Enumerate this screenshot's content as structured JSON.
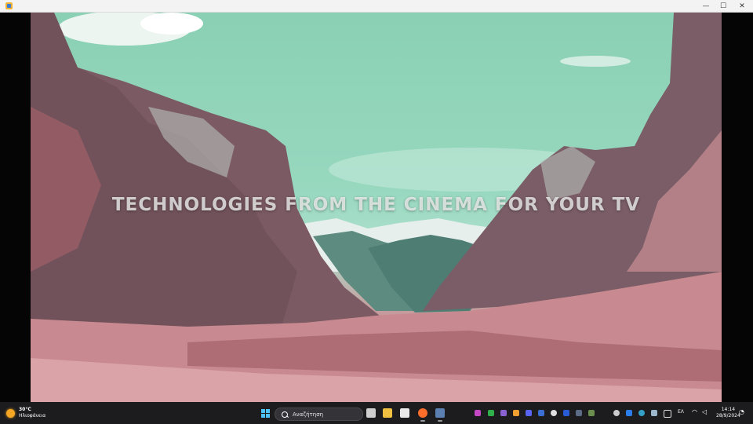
{
  "window": {
    "title_icon": "media-player-icon",
    "controls": {
      "minimize": "—",
      "maximize": "☐",
      "close": "✕"
    }
  },
  "video": {
    "overlay_text": "TECHNOLOGIES FROM THE CINEMA FOR YOUR TV",
    "colors": {
      "sky": "#93d5bb",
      "mountain": "#8a5f68",
      "foliage": "#c98f94"
    }
  },
  "taskbar": {
    "weather": {
      "temperature": "30°C",
      "condition": "Ηλιοφάνεια",
      "icon": "sun-icon"
    },
    "search_placeholder": "Αναζήτηση",
    "pinned_apps": [
      "start-icon",
      "task-view-icon",
      "file-explorer-icon",
      "store-icon",
      "firefox-icon",
      "media-player-icon"
    ],
    "language": "ΕΛ",
    "time": "14:14",
    "date": "28/9/2024"
  }
}
